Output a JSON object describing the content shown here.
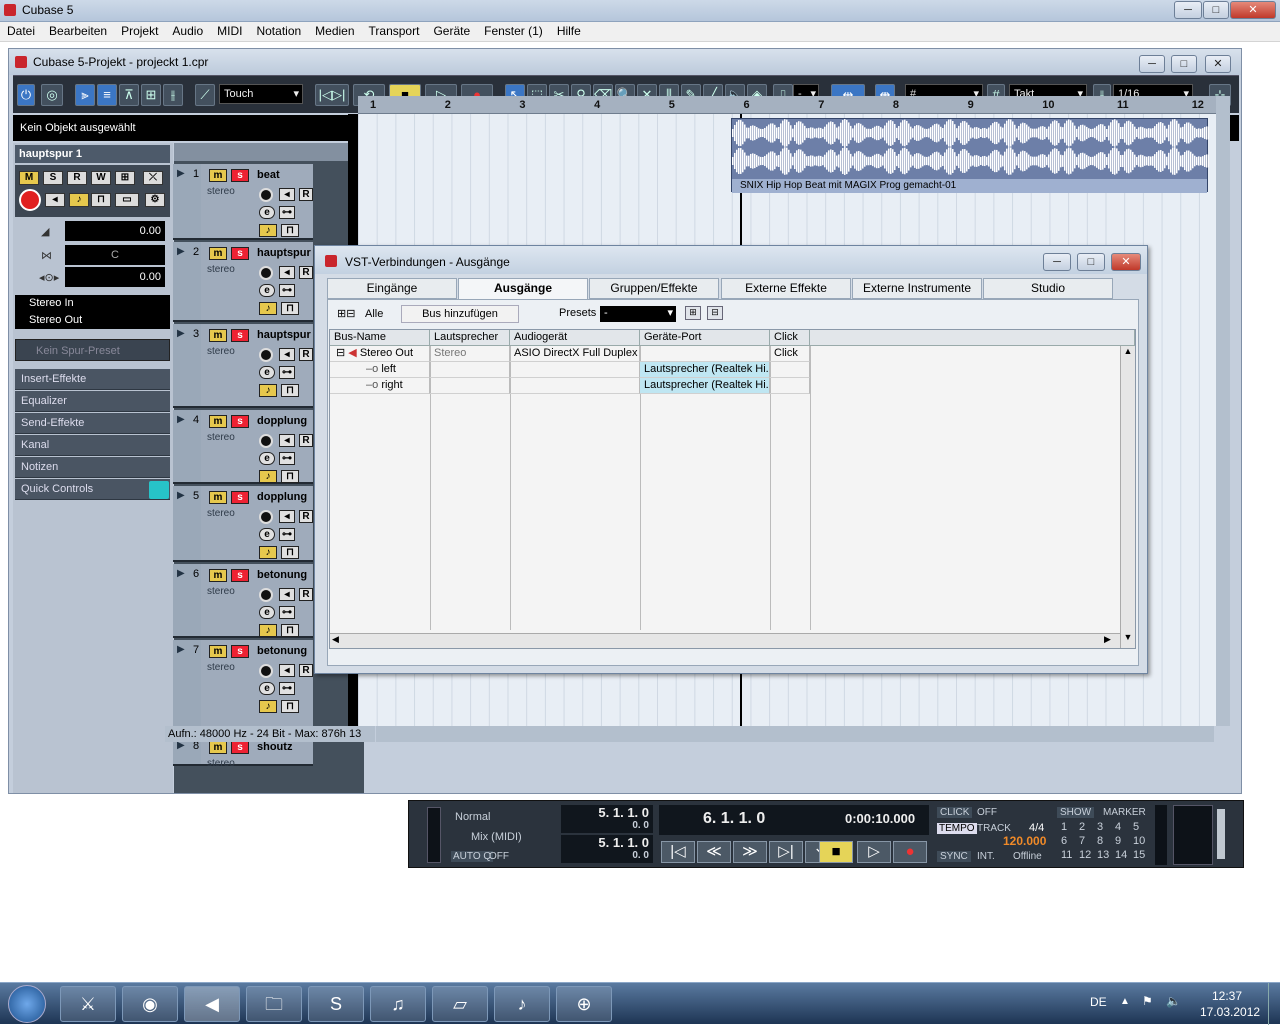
{
  "os": {
    "title": "Cubase 5",
    "min": "─",
    "max": "□",
    "close": "✕"
  },
  "menu": [
    "Datei",
    "Bearbeiten",
    "Projekt",
    "Audio",
    "MIDI",
    "Notation",
    "Medien",
    "Transport",
    "Geräte",
    "Fenster (1)",
    "Hilfe"
  ],
  "project": {
    "title": "Cubase 5-Projekt - projeckt 1.cpr",
    "automation_mode": "Touch",
    "grid_type": "Takt",
    "quantize": "1/16",
    "nudge_value": "-",
    "info_line": "Kein Objekt ausgewählt"
  },
  "inspector": {
    "track_name": "hauptspur 1",
    "volume": "0.00",
    "pan": "C",
    "delay": "0.00",
    "input": "Stereo In",
    "output": "Stereo Out",
    "preset": "Kein Spur-Preset",
    "sections": [
      "Insert-Effekte",
      "Equalizer",
      "Send-Effekte",
      "Kanal",
      "Notizen",
      "Quick Controls"
    ]
  },
  "tracks": [
    {
      "num": "1",
      "name": "beat",
      "type": "stereo"
    },
    {
      "num": "2",
      "name": "hauptspur",
      "type": "stereo"
    },
    {
      "num": "3",
      "name": "hauptspur",
      "type": "stereo"
    },
    {
      "num": "4",
      "name": "dopplung",
      "type": "stereo"
    },
    {
      "num": "5",
      "name": "dopplung",
      "type": "stereo"
    },
    {
      "num": "6",
      "name": "betonung",
      "type": "stereo"
    },
    {
      "num": "7",
      "name": "betonung",
      "type": "stereo"
    },
    {
      "num": "8",
      "name": "shoutz",
      "type": "stereo"
    }
  ],
  "ruler": [
    "1",
    "2",
    "3",
    "4",
    "5",
    "6",
    "7",
    "8",
    "9",
    "10",
    "11",
    "12"
  ],
  "event_label": "SNIX Hip Hop Beat mit MAGIX Prog gemacht-01",
  "status_line": "Aufn.: 48000 Hz - 24 Bit - Max: 876h 13",
  "dialog": {
    "title": "VST-Verbindungen - Ausgänge",
    "tabs": [
      "Eingänge",
      "Ausgänge",
      "Gruppen/Effekte",
      "Externe Effekte",
      "Externe Instrumente",
      "Studio"
    ],
    "active_tab": "Ausgänge",
    "all_label": "Alle",
    "add_bus": "Bus hinzufügen",
    "presets_label": "Presets",
    "presets_value": "-",
    "columns": [
      "Bus-Name",
      "Lautsprecher",
      "Audiogerät",
      "Geräte-Port",
      "Click"
    ],
    "rows": [
      {
        "name": "Stereo Out",
        "speaker": "Stereo",
        "device": "ASIO DirectX Full Duplex D",
        "port": "",
        "click": "Click"
      },
      {
        "name": "left",
        "speaker": "",
        "device": "",
        "port": "Lautsprecher (Realtek Hi...",
        "click": ""
      },
      {
        "name": "right",
        "speaker": "",
        "device": "",
        "port": "Lautsprecher (Realtek Hi...",
        "click": ""
      }
    ]
  },
  "transport": {
    "mode": "Normal",
    "mix_mode": "Mix (MIDI)",
    "auto_q": "AUTO Q",
    "auto_q_state": "OFF",
    "left_locator": "5. 1. 1. 0",
    "left_sub": "0. 0",
    "right_locator": "5. 1. 1. 0",
    "right_sub": "0. 0",
    "position": "6. 1. 1. 0",
    "time": "0:00:10.000",
    "click_label": "CLICK",
    "click_state": "OFF",
    "tempo_label": "TEMPO",
    "track_label": "TRACK",
    "signature": "4/4",
    "tempo": "120.000",
    "sync_label": "SYNC",
    "sync_int": "INT.",
    "sync_state": "Offline",
    "show_label": "SHOW",
    "marker_label": "MARKER",
    "markers": [
      "1",
      "2",
      "3",
      "4",
      "5",
      "6",
      "7",
      "8",
      "9",
      "10",
      "11",
      "12",
      "13",
      "14",
      "15"
    ]
  },
  "taskbar": {
    "lang": "DE",
    "time": "12:37",
    "date": "17.03.2012"
  }
}
